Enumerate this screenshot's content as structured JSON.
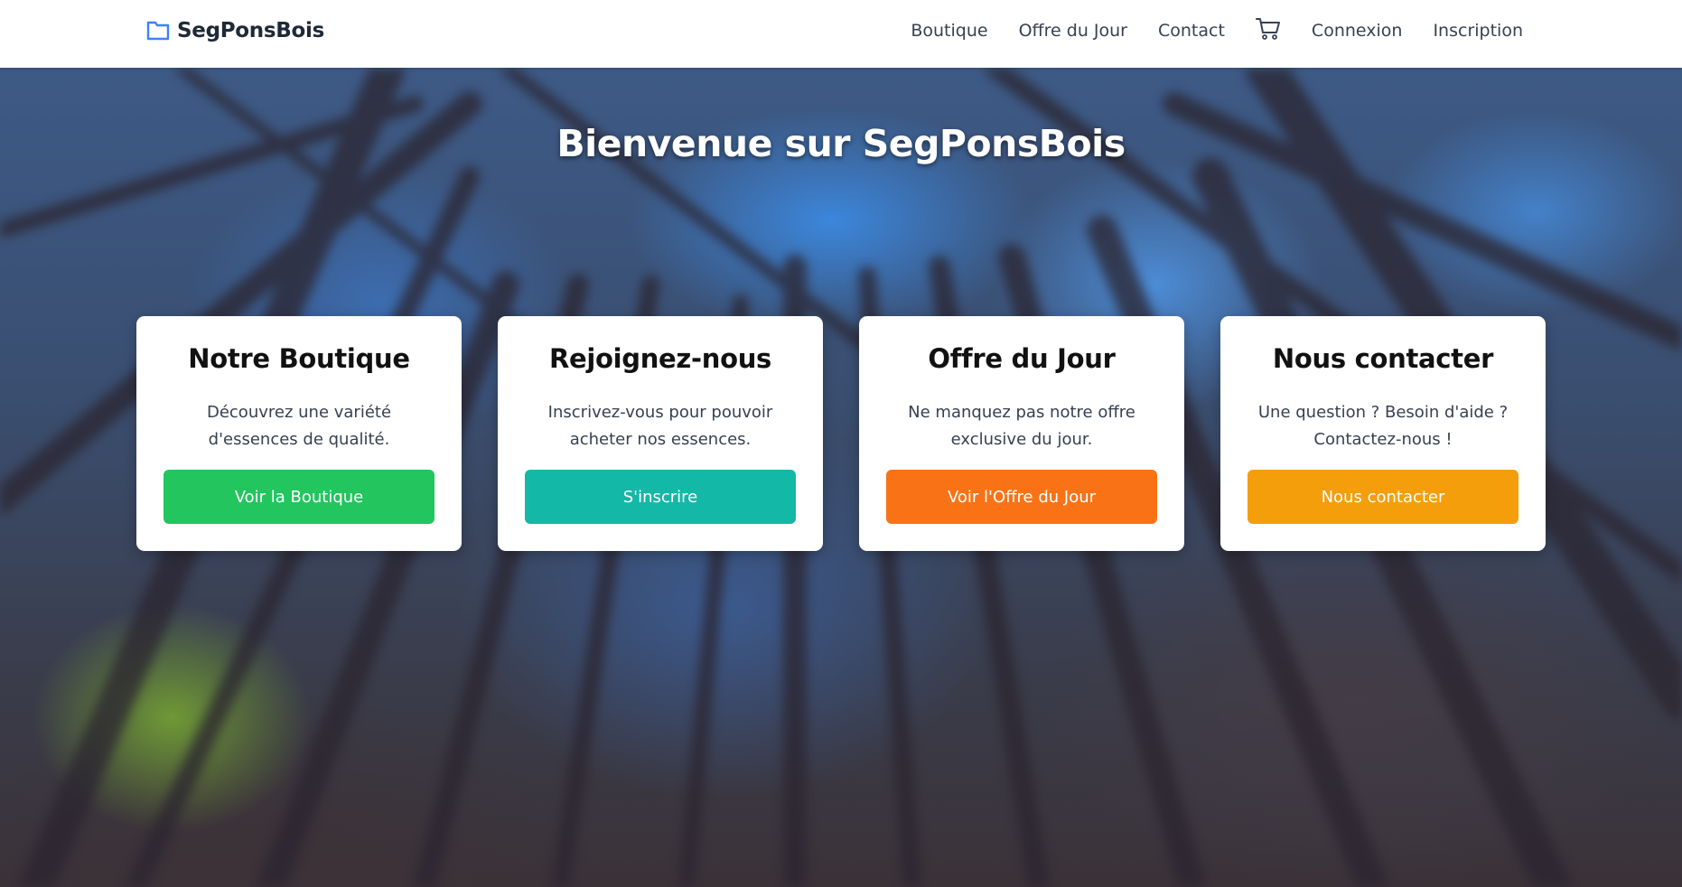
{
  "brand": {
    "name": "SegPonsBois",
    "icon": "folder-icon",
    "icon_color": "#3b82f6"
  },
  "nav": {
    "items": [
      {
        "label": "Boutique"
      },
      {
        "label": "Offre du Jour"
      },
      {
        "label": "Contact"
      },
      {
        "label": "Connexion"
      },
      {
        "label": "Inscription"
      }
    ],
    "cart_icon": "cart-icon"
  },
  "hero": {
    "title": "Bienvenue sur SegPonsBois"
  },
  "cards": [
    {
      "title": "Notre Boutique",
      "text": "Découvrez une variété d'essences de qualité.",
      "button": "Voir la Boutique",
      "button_color": "#22c55e"
    },
    {
      "title": "Rejoignez-nous",
      "text": "Inscrivez-vous pour pouvoir acheter nos essences.",
      "button": "S'inscrire",
      "button_color": "#14b8a6"
    },
    {
      "title": "Offre du Jour",
      "text": "Ne manquez pas notre offre exclusive du jour.",
      "button": "Voir l'Offre du Jour",
      "button_color": "#f97316"
    },
    {
      "title": "Nous contacter",
      "text": "Une question ? Besoin d'aide ? Contactez-nous !",
      "button": "Nous contacter",
      "button_color": "#f59e0b"
    }
  ]
}
